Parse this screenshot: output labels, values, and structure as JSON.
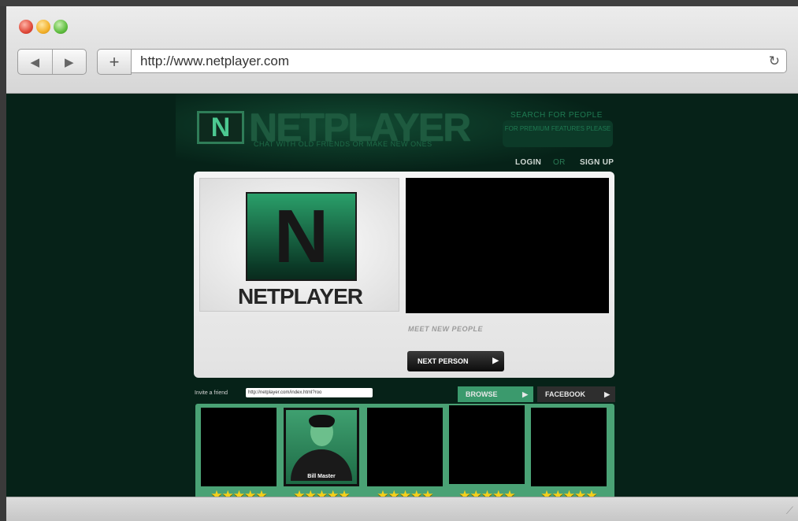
{
  "browser": {
    "url": "http://www.netplayer.com",
    "back_icon": "back-arrow-icon",
    "forward_icon": "forward-arrow-icon",
    "add_icon": "plus-icon",
    "reload_icon": "reload-icon"
  },
  "site": {
    "logo_letter": "N",
    "logo_text": "NETPLAYER",
    "tagline": "CHAT WITH OLD FRIENDS OR MAKE NEW ONES",
    "search_label": "SEARCH FOR PEOPLE",
    "premium_text": "FOR PREMIUM FEATURES PLEASE",
    "login_label": "LOGIN",
    "or_label": "OR",
    "signup_label": "SIGN UP"
  },
  "main": {
    "emblem_letter": "N",
    "emblem_label": "NETPLAYER",
    "meet_text": "MEET NEW PEOPLE",
    "next_button": "NEXT PERSON",
    "next_arrow": "▶"
  },
  "invite": {
    "label": "Invite a friend",
    "value": "http://netplayer.com/index.html?roo"
  },
  "tabs": {
    "browse": "BROWSE",
    "facebook": "FACEBOOK",
    "arrow": "▶"
  },
  "people": [
    {
      "name": "",
      "stars": "★★★★★"
    },
    {
      "name": "Bill Master",
      "stars": "★★★★★"
    },
    {
      "name": "",
      "stars": "★★★★★"
    },
    {
      "name": "",
      "stars": "★★★★★"
    },
    {
      "name": "",
      "stars": "★★★★★"
    }
  ],
  "colors": {
    "page_bg": "#062218",
    "accent_green": "#3b9a6d",
    "star_yellow": "#f4d01c"
  }
}
